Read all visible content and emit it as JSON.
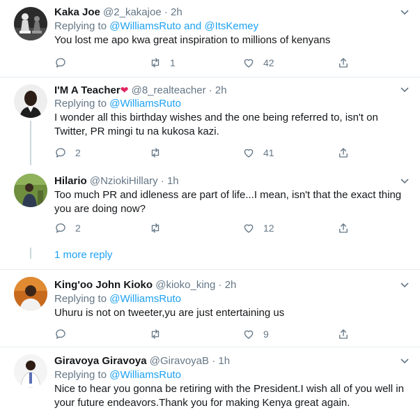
{
  "tweets": [
    {
      "name": "Kaka Joe",
      "emoji": "",
      "handle": "@2_kakajoe",
      "time": "2h",
      "replying_label": "Replying to",
      "mention1": "@WilliamsRuto",
      "conj": "and",
      "mention2": "@ItsKemey",
      "text": "You lost me apo kwa great inspiration to millions of kenyans",
      "replies": "",
      "retweets": "1",
      "likes": "42"
    },
    {
      "name": "I'M A Teacher",
      "emoji": "❤",
      "handle": "@8_realteacher",
      "time": "2h",
      "replying_label": "Replying to",
      "mention1": "@WilliamsRuto",
      "text": "I wonder all this birthday wishes and the one being referred to, isn't on Twitter, PR mingi tu na kukosa kazi.",
      "replies": "2",
      "retweets": "",
      "likes": "41"
    },
    {
      "name": "Hilario",
      "emoji": "",
      "handle": "@NziokiHillary",
      "time": "1h",
      "text": "Too much PR and idleness are part of life...I mean, isn't that the exact thing you are doing now?",
      "replies": "2",
      "retweets": "",
      "likes": "12"
    },
    {
      "name": "King'oo John Kioko",
      "emoji": "",
      "handle": "@kioko_king",
      "time": "2h",
      "replying_label": "Replying to",
      "mention1": "@WilliamsRuto",
      "text": "Uhuru is not on tweeter,yu are just entertaining us",
      "replies": "",
      "retweets": "",
      "likes": "9"
    },
    {
      "name": "Giravoya Giravoya",
      "emoji": "",
      "handle": "@GiravoyaB",
      "time": "1h",
      "replying_label": "Replying to",
      "mention1": "@WilliamsRuto",
      "text": "Nice to hear you gonna be retiring with the President.I wish all of you well in your future endeavors.Thank you for making Kenya great again."
    }
  ],
  "more_reply": "1 more reply",
  "dot": "·",
  "colors": {
    "accent": "#1da1f2",
    "muted": "#657786",
    "border": "#e6ecf0",
    "heart": "#e0245e"
  },
  "icons": {
    "reply": "reply-icon",
    "retweet": "retweet-icon",
    "like": "heart-icon",
    "share": "share-icon",
    "menu": "chevron-down-icon"
  }
}
